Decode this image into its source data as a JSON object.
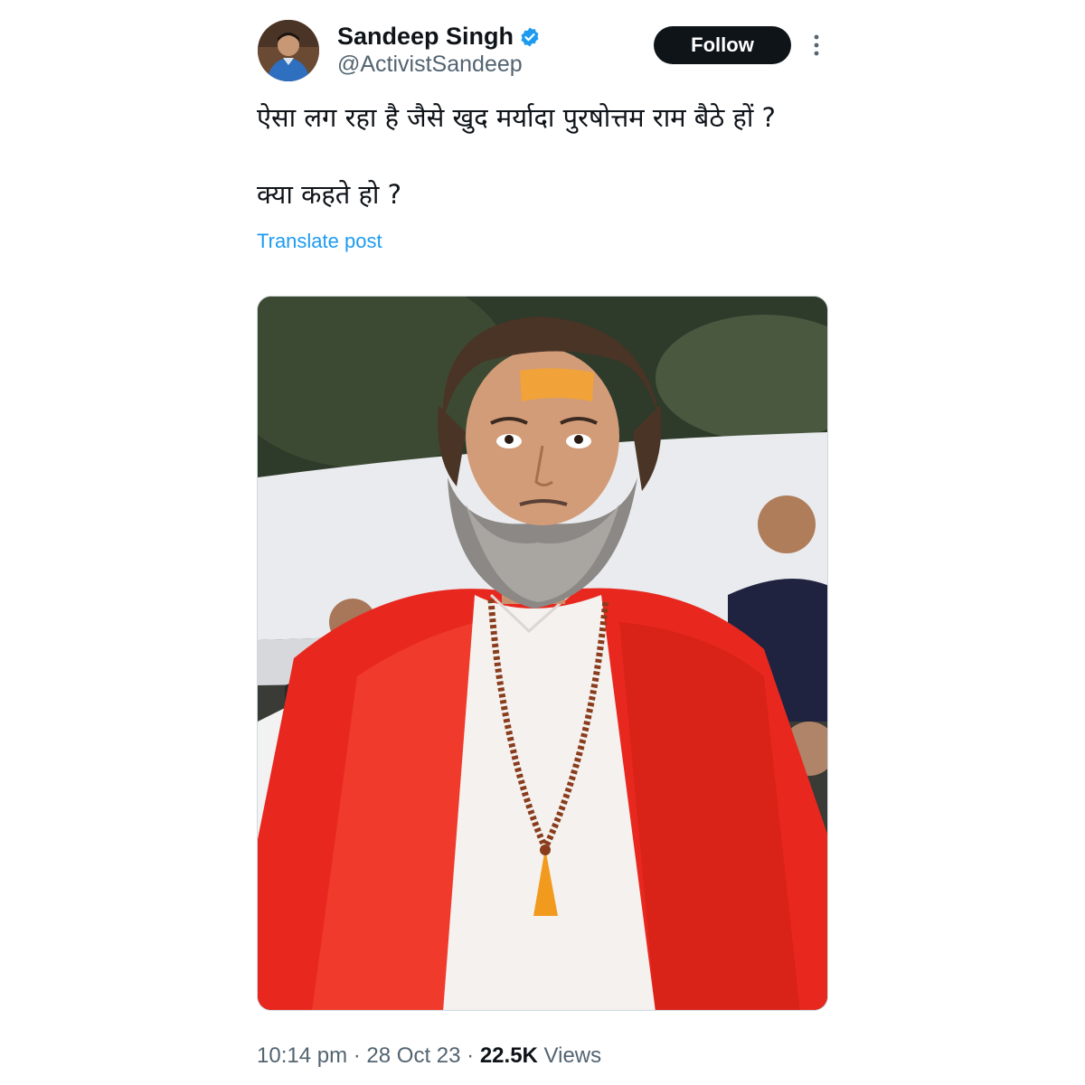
{
  "author": {
    "display_name": "Sandeep Singh",
    "handle": "@ActivistSandeep",
    "verified": true,
    "avatar_icon": "user-avatar"
  },
  "actions": {
    "follow_label": "Follow",
    "more_icon": "more-vertical-icon"
  },
  "tweet": {
    "line_1": "ऐसा लग रहा है जैसे खुद मर्यादा पुरषोत्तम राम बैठे हों ?",
    "line_2": "क्या कहते हो ?",
    "translate_label": "Translate post"
  },
  "media": {
    "type": "photo"
  },
  "meta": {
    "time": "10:14 pm",
    "separator": "·",
    "date": "28 Oct 23",
    "views_count": "22.5K",
    "views_label": "Views"
  },
  "colors": {
    "text_primary": "#0f1419",
    "text_secondary": "#536471",
    "link": "#1d9bf0",
    "verified_badge": "#1d9bf0",
    "follow_button_bg": "#0f1419"
  }
}
